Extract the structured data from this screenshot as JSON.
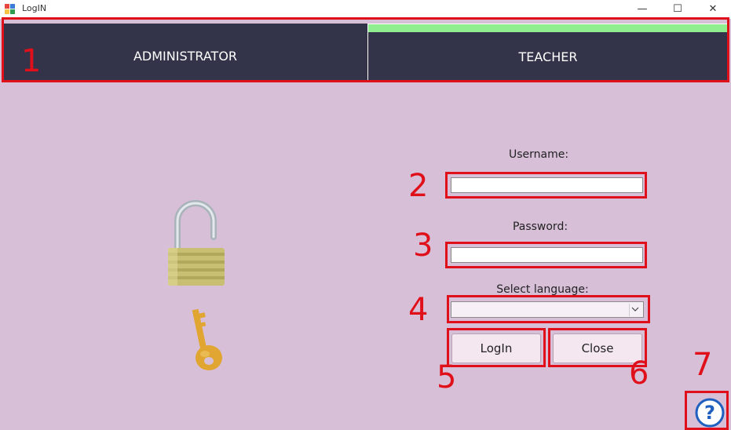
{
  "window": {
    "title": "LogIN",
    "minimize_glyph": "—",
    "maximize_glyph": "☐",
    "close_glyph": "✕"
  },
  "tabs": [
    {
      "label": "ADMINISTRATOR"
    },
    {
      "label": "TEACHER"
    }
  ],
  "form": {
    "username_label": "Username:",
    "username_value": "",
    "password_label": "Password:",
    "password_value": "",
    "language_label": "Select language:",
    "language_value": "",
    "login_label": "LogIn",
    "close_label": "Close"
  },
  "callouts": [
    "1",
    "2",
    "3",
    "4",
    "5",
    "6",
    "7"
  ],
  "icons": {
    "lock": "padlock-icon",
    "key": "key-icon",
    "help": "help-icon"
  },
  "colors": {
    "background": "#d8bfd8",
    "tab_bar": "#33334a",
    "tab_indicator": "#90ee90",
    "callout": "#e0101b"
  }
}
